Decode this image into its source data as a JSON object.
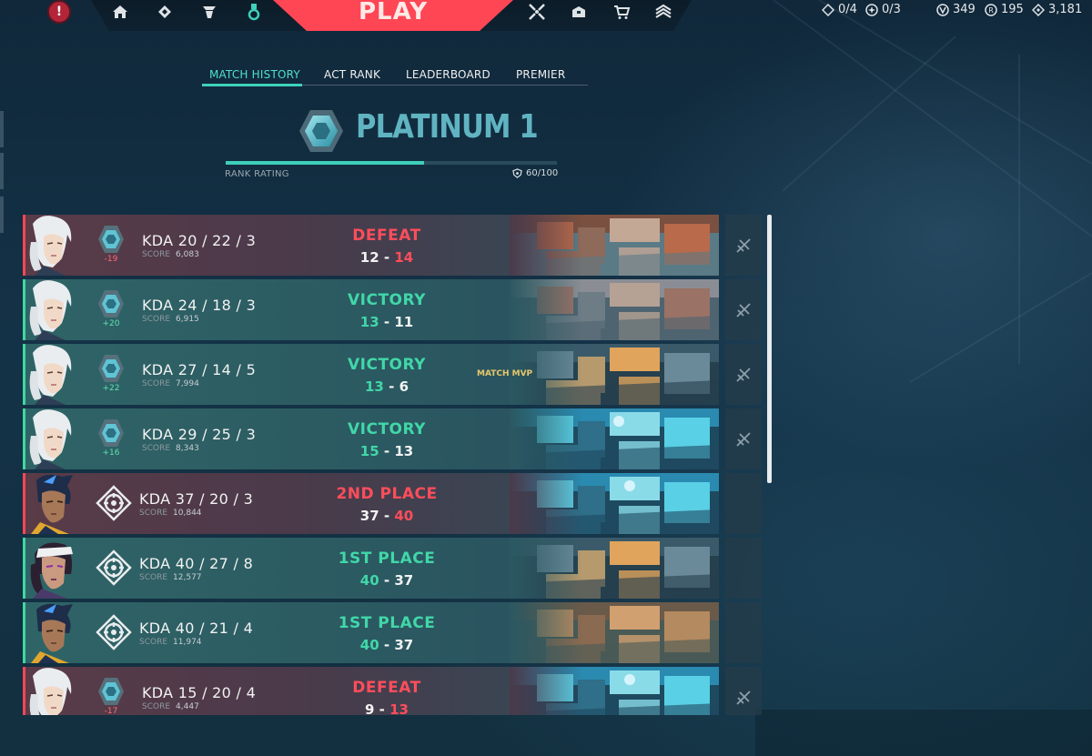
{
  "colors": {
    "accent_red": "#ff4655",
    "accent_teal": "#3fd0ba",
    "win_green": "#41d7a8",
    "loss_red": "#ff4d5b",
    "rank_text": "#60b4c2",
    "mvp_gold": "#e8c86a"
  },
  "topnav": {
    "alert_icon": "alert-icon",
    "left_icons": [
      "home-icon",
      "battlepass-icon",
      "agents-icon",
      "career-icon"
    ],
    "play_label": "PLAY",
    "right_icons": [
      "crosshair-icon",
      "collection-icon",
      "store-icon",
      "rank-icon"
    ],
    "status": {
      "kingdom_credits": "0/4",
      "radianite_points_progress": "0/3",
      "valorant_points": "349",
      "radianite": "195",
      "kingdom": "3,181"
    }
  },
  "tabs": [
    {
      "label": "MATCH HISTORY",
      "active": true
    },
    {
      "label": "ACT RANK",
      "active": false
    },
    {
      "label": "LEADERBOARD",
      "active": false
    },
    {
      "label": "PREMIER",
      "active": false
    }
  ],
  "rank": {
    "title": "PLATINUM 1",
    "rating_label": "RANK RATING",
    "rating_value": "60/100",
    "rating_fraction": 0.6
  },
  "matches": [
    {
      "outcome": "loss",
      "agent": "jett",
      "badge": "rank",
      "rr_delta": "-19",
      "kda": "KDA 20 / 22 / 3",
      "score_label": "SCORE",
      "score": "6,083",
      "result": "DEFEAT",
      "team_score": "12",
      "enemy_score": "14",
      "map": "split",
      "mvp": ""
    },
    {
      "outcome": "win",
      "agent": "jett",
      "badge": "rank",
      "rr_delta": "+20",
      "kda": "KDA 24 / 18 / 3",
      "score_label": "SCORE",
      "score": "6,915",
      "result": "VICTORY",
      "team_score": "13",
      "enemy_score": "11",
      "map": "bind",
      "mvp": ""
    },
    {
      "outcome": "win",
      "agent": "jett",
      "badge": "rank",
      "rr_delta": "+22",
      "kda": "KDA 27 / 14 / 5",
      "score_label": "SCORE",
      "score": "7,994",
      "result": "VICTORY",
      "team_score": "13",
      "enemy_score": "6",
      "map": "ascent",
      "mvp": "MATCH MVP"
    },
    {
      "outcome": "win",
      "agent": "jett",
      "badge": "rank",
      "rr_delta": "+16",
      "kda": "KDA 29 / 25 / 3",
      "score_label": "SCORE",
      "score": "8,343",
      "result": "VICTORY",
      "team_score": "15",
      "enemy_score": "13",
      "map": "pearl",
      "mvp": ""
    },
    {
      "outcome": "loss",
      "agent": "neon",
      "badge": "deathmatch",
      "rr_delta": "",
      "kda": "KDA 37 / 20 / 3",
      "score_label": "SCORE",
      "score": "10,844",
      "result": "2ND PLACE",
      "team_score": "37",
      "enemy_score": "40",
      "map": "pearl",
      "mvp": ""
    },
    {
      "outcome": "win",
      "agent": "reyna",
      "badge": "deathmatch",
      "rr_delta": "",
      "kda": "KDA 40 / 27 / 8",
      "score_label": "SCORE",
      "score": "12,577",
      "result": "1ST PLACE",
      "team_score": "40",
      "enemy_score": "37",
      "map": "ascent",
      "mvp": ""
    },
    {
      "outcome": "win",
      "agent": "neon",
      "badge": "deathmatch",
      "rr_delta": "",
      "kda": "KDA 40 / 21 / 4",
      "score_label": "SCORE",
      "score": "11,974",
      "result": "1ST PLACE",
      "team_score": "40",
      "enemy_score": "37",
      "map": "haven",
      "mvp": ""
    },
    {
      "outcome": "loss",
      "agent": "jett",
      "badge": "rank",
      "rr_delta": "-17",
      "kda": "KDA 15 / 20 / 4",
      "score_label": "SCORE",
      "score": "4,447",
      "result": "DEFEAT",
      "team_score": "9",
      "enemy_score": "13",
      "map": "pearl",
      "mvp": ""
    }
  ]
}
